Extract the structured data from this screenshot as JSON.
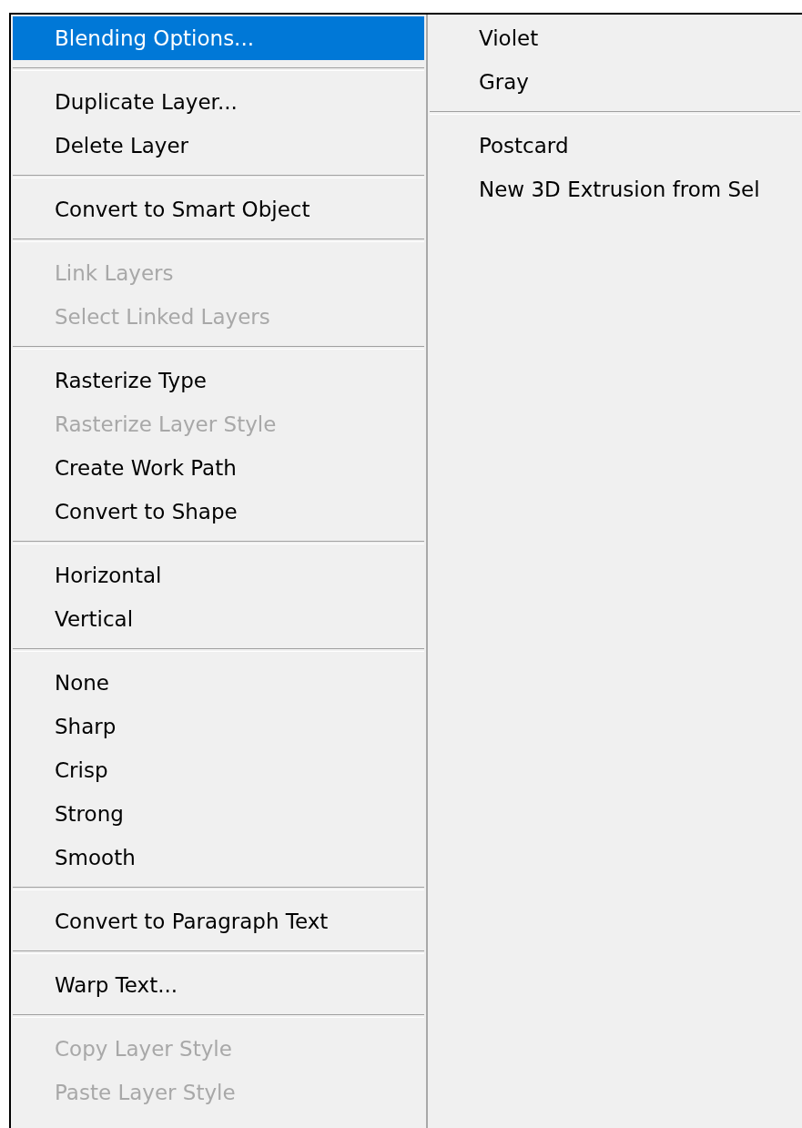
{
  "left_menu": {
    "groups": [
      {
        "items": [
          {
            "label": "Blending Options...",
            "selected": true,
            "disabled": false
          }
        ]
      },
      {
        "items": [
          {
            "label": "Duplicate Layer...",
            "selected": false,
            "disabled": false
          },
          {
            "label": "Delete Layer",
            "selected": false,
            "disabled": false
          }
        ]
      },
      {
        "items": [
          {
            "label": "Convert to Smart Object",
            "selected": false,
            "disabled": false
          }
        ]
      },
      {
        "items": [
          {
            "label": "Link Layers",
            "selected": false,
            "disabled": true
          },
          {
            "label": "Select Linked Layers",
            "selected": false,
            "disabled": true
          }
        ]
      },
      {
        "items": [
          {
            "label": "Rasterize Type",
            "selected": false,
            "disabled": false
          },
          {
            "label": "Rasterize Layer Style",
            "selected": false,
            "disabled": true
          },
          {
            "label": "Create Work Path",
            "selected": false,
            "disabled": false
          },
          {
            "label": "Convert to Shape",
            "selected": false,
            "disabled": false
          }
        ]
      },
      {
        "items": [
          {
            "label": "Horizontal",
            "selected": false,
            "disabled": false
          },
          {
            "label": "Vertical",
            "selected": false,
            "disabled": false
          }
        ]
      },
      {
        "items": [
          {
            "label": "None",
            "selected": false,
            "disabled": false
          },
          {
            "label": "Sharp",
            "selected": false,
            "disabled": false
          },
          {
            "label": "Crisp",
            "selected": false,
            "disabled": false
          },
          {
            "label": "Strong",
            "selected": false,
            "disabled": false
          },
          {
            "label": "Smooth",
            "selected": false,
            "disabled": false
          }
        ]
      },
      {
        "items": [
          {
            "label": "Convert to Paragraph Text",
            "selected": false,
            "disabled": false
          }
        ]
      },
      {
        "items": [
          {
            "label": "Warp Text...",
            "selected": false,
            "disabled": false
          }
        ]
      },
      {
        "items": [
          {
            "label": "Copy Layer Style",
            "selected": false,
            "disabled": true
          },
          {
            "label": "Paste Layer Style",
            "selected": false,
            "disabled": true
          }
        ]
      }
    ]
  },
  "right_menu": {
    "groups": [
      {
        "items": [
          {
            "label": "Violet",
            "selected": false,
            "disabled": false
          },
          {
            "label": "Gray",
            "selected": false,
            "disabled": false
          }
        ]
      },
      {
        "items": [
          {
            "label": "Postcard",
            "selected": false,
            "disabled": false
          },
          {
            "label": "New 3D Extrusion from Sel",
            "selected": false,
            "disabled": false
          }
        ]
      }
    ]
  }
}
